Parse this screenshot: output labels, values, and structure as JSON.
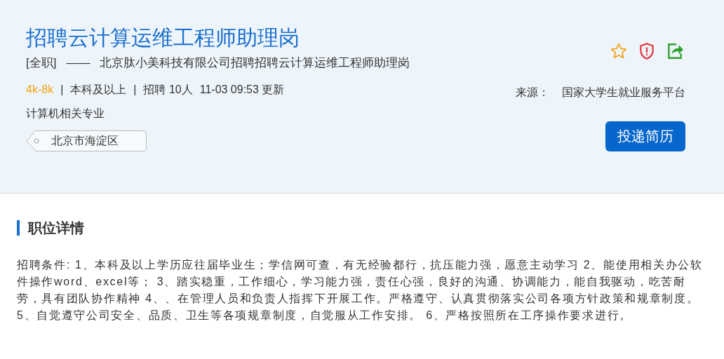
{
  "job": {
    "title": "招聘云计算运维工程师助理岗",
    "type": "[全职]",
    "dash": "——",
    "company_line": "北京肽小美科技有限公司招聘招聘云计算运维工程师助理岗",
    "salary": "4k-8k",
    "separator": "|",
    "education": "本科及以上",
    "headcount": "招聘 10人",
    "updated": "11-03 09:53 更新",
    "major": "计算机相关专业",
    "location": "北京市海淀区",
    "source_label": "来源：",
    "source": "国家大学生就业服务平台",
    "apply_button": "投递简历"
  },
  "details": {
    "heading": "职位详情",
    "text": "招聘条件: 1、本科及以上学历应往届毕业生；学信网可查，有无经验都行，抗压能力强，愿意主动学习 2、能使用相关办公软件操作word、excel等； 3、踏实稳重，工作细心，学习能力强，责任心强，良好的沟通、协调能力，能自我驱动，吃苦耐劳，具有团队协作精神 4、、在管理人员和负责人指挥下开展工作。严格遵守、认真贯彻落实公司各项方针政策和规章制度。 5、自觉遵守公司安全、品质、卫生等各项规章制度，自觉服从工作安排。 6、严格按照所在工序操作要求进行。"
  }
}
